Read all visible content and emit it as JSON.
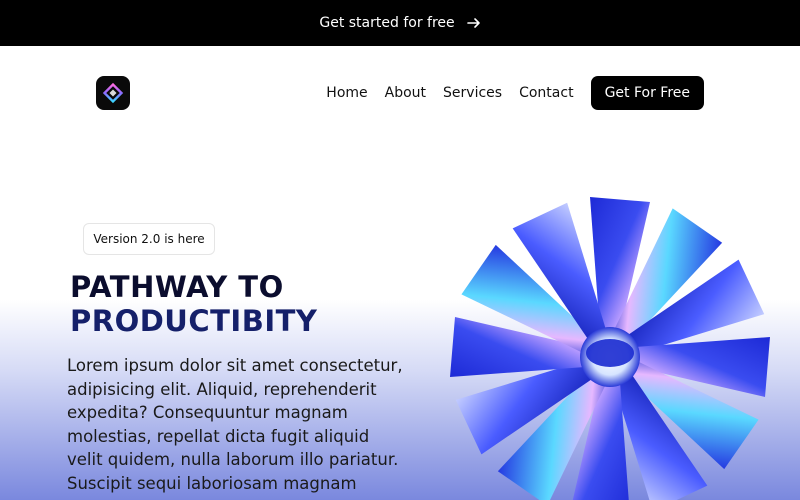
{
  "announcement": {
    "text": "Get started for free",
    "icon": "arrow-right-icon"
  },
  "header": {
    "logo_icon": "app-logo-icon",
    "nav": [
      "Home",
      "About",
      "Services",
      "Contact"
    ],
    "cta": "Get For Free"
  },
  "hero": {
    "badge": "Version 2.0 is here",
    "title_line1": "PATHWAY TO",
    "title_line2": "PRODUCTIBITY",
    "body": "Lorem ipsum dolor sit amet consectetur, adipisicing elit. Aliquid, reprehenderit expedita? Consequuntur magnam molestias, repellat dicta fugit aliquid velit quidem, nulla laborum illo pariatur. Suscipit sequi laboriosam magnam",
    "illustration": "iridescent-wheel-illustration"
  },
  "colors": {
    "topbar_bg": "#000000",
    "title_dark": "#0b0d2e",
    "title_navy": "#15206a",
    "wheel_blue": "#2a3bd8"
  }
}
